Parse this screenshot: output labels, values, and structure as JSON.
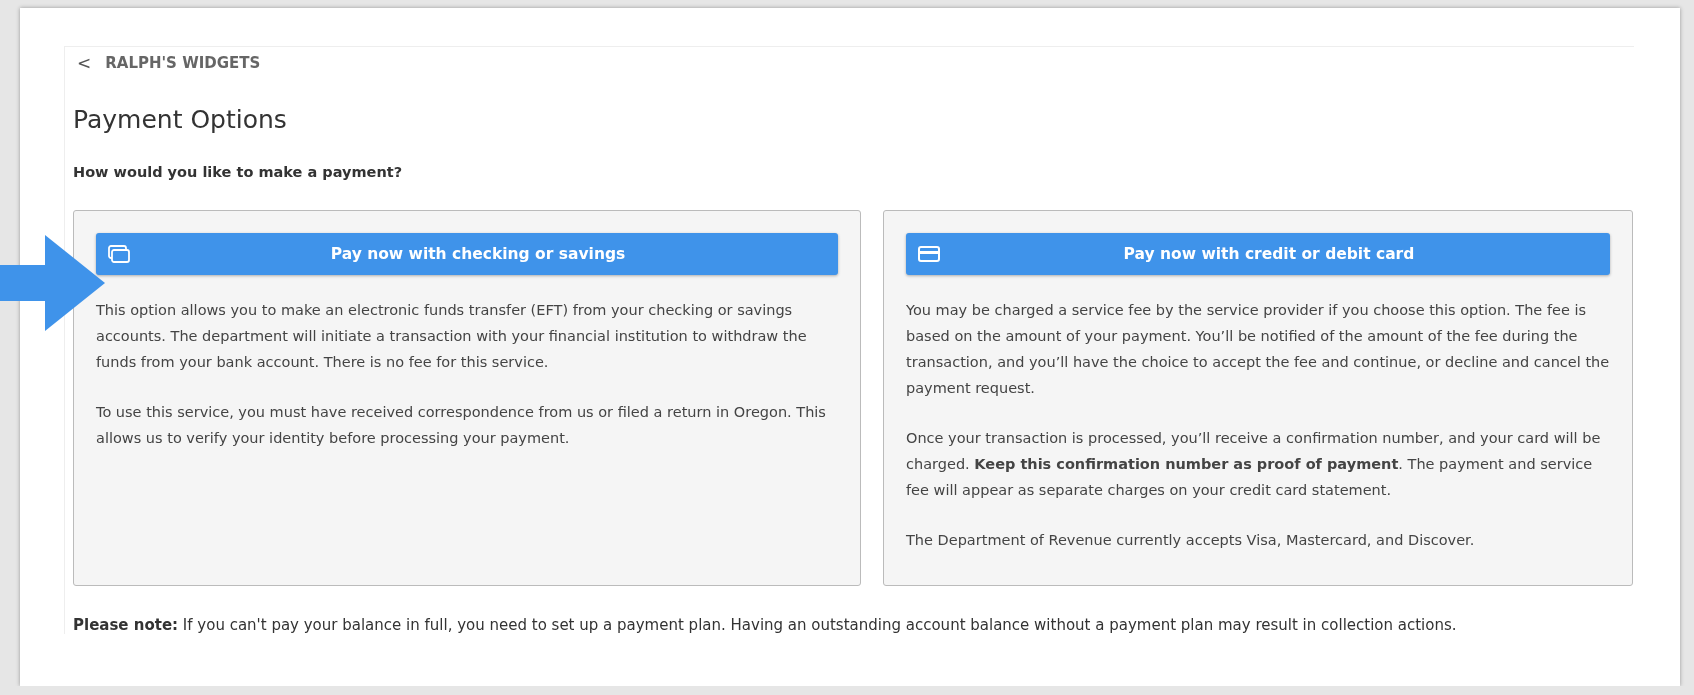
{
  "breadcrumb": {
    "back_glyph": "<",
    "label": "RALPH'S WIDGETS"
  },
  "title": "Payment Options",
  "question": "How would you like to make a payment?",
  "options": [
    {
      "kind": "bank",
      "button": "Pay now with checking or savings",
      "paragraphs": [
        "This option allows you to make an electronic funds transfer (EFT) from your checking or savings accounts. The department will initiate a transaction with your financial institution to withdraw the funds from your bank account. There is no fee for this service.",
        "To use this service, you must have received correspondence from us or filed a return in Oregon. This allows us to verify your identity before processing your payment."
      ]
    },
    {
      "kind": "card",
      "button": "Pay now with credit or debit card",
      "paragraphs": [
        "You may be charged a service fee by the service provider if you choose this option. The fee is based on the amount of your payment. You’ll be notified of the amount of the fee during the transaction, and you’ll have the choice to accept the fee and continue, or decline and cancel the payment request.",
        "Once your transaction is processed, you’ll receive a confirmation number, and your card will be charged. **Keep this confirmation number as proof of payment**. The payment and service fee will appear as separate charges on your credit card statement.",
        "The Department of Revenue currently accepts Visa, Mastercard, and Discover."
      ]
    }
  ],
  "note": "**Please note:** If you can't pay your balance in full, you need to set up a payment plan. Having an outstanding account balance without a payment plan may result in collection actions."
}
